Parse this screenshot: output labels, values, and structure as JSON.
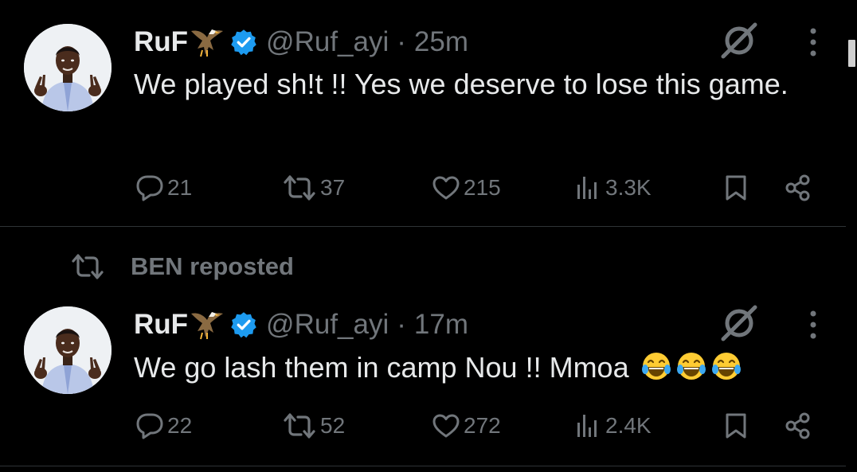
{
  "colors": {
    "background": "#000000",
    "text_primary": "#e7e9ea",
    "text_secondary": "#71767b",
    "verified_blue": "#1d9bf0",
    "divider": "#2f3336"
  },
  "tweets": [
    {
      "author": {
        "name": "RuF",
        "name_emoji_icon": "eagle-icon",
        "verified": true,
        "handle": "@Ruf_ayi",
        "separator": "·",
        "time": "25m"
      },
      "text": "We played sh!t !! Yes we deserve to lose this game.",
      "metrics": {
        "replies": "21",
        "reposts": "37",
        "likes": "215",
        "views": "3.3K"
      }
    },
    {
      "social_context": {
        "icon": "repost-icon",
        "label": "BEN reposted"
      },
      "author": {
        "name": "RuF",
        "name_emoji_icon": "eagle-icon",
        "verified": true,
        "handle": "@Ruf_ayi",
        "separator": "·",
        "time": "17m"
      },
      "text": "We go lash them in camp Nou !! Mmoa",
      "text_emoji_icons": [
        "tears-of-joy-emoji",
        "tears-of-joy-emoji",
        "tears-of-joy-emoji"
      ],
      "metrics": {
        "replies": "22",
        "reposts": "52",
        "likes": "272",
        "views": "2.4K"
      }
    }
  ]
}
